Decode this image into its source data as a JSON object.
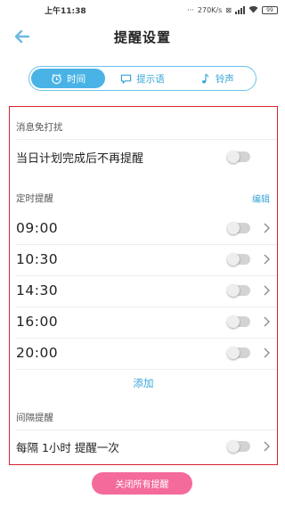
{
  "status_bar": {
    "time": "上午11:38",
    "speed": "270K/s",
    "battery": "99"
  },
  "header": {
    "title": "提醒设置"
  },
  "tabs": [
    {
      "label": "时间",
      "icon": "alarm-clock-icon",
      "active": true
    },
    {
      "label": "提示语",
      "icon": "message-icon",
      "active": false
    },
    {
      "label": "铃声",
      "icon": "music-note-icon",
      "active": false
    }
  ],
  "dnd": {
    "section_label": "消息免打扰",
    "item_label": "当日计划完成后不再提醒",
    "enabled": false
  },
  "timed": {
    "section_label": "定时提醒",
    "edit_label": "编辑",
    "add_label": "添加",
    "items": [
      {
        "time": "09:00",
        "enabled": false
      },
      {
        "time": "10:30",
        "enabled": false
      },
      {
        "time": "14:30",
        "enabled": false
      },
      {
        "time": "16:00",
        "enabled": false
      },
      {
        "time": "20:00",
        "enabled": false
      }
    ]
  },
  "interval": {
    "section_label": "间隔提醒",
    "item_label": "每隔 1小时 提醒一次",
    "enabled": false
  },
  "footer": {
    "close_all_label": "关闭所有提醒"
  },
  "colors": {
    "accent": "#4ab3e6",
    "close_button": "#f46a9b",
    "highlight_border": "#d9232d"
  }
}
